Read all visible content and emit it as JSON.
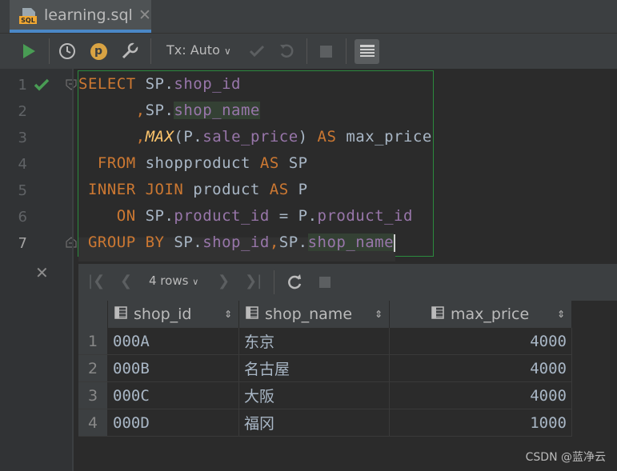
{
  "tab": {
    "name": "learning.sql",
    "icon": "sql-file-icon",
    "close": "✕"
  },
  "toolbar": {
    "tx_mode": "Tx: Auto",
    "p_badge": "p"
  },
  "editor": {
    "line_numbers": [
      "1",
      "2",
      "3",
      "4",
      "5",
      "6",
      "7"
    ],
    "line1": {
      "kw": "SELECT",
      "t1": " SP.",
      "f1": "shop_id"
    },
    "line2": {
      "t0": "      ",
      "comma": ",",
      "t1": "SP.",
      "f1": "shop_name"
    },
    "line3": {
      "t0": "      ",
      "comma": ",",
      "fn": "MAX",
      "t1": "(P.",
      "f1": "sale_price",
      "t2": ") ",
      "kw": "AS",
      "t3": " max_price"
    },
    "line4": {
      "t0": "  ",
      "kw": "FROM",
      "t1": " shopproduct ",
      "kw2": "AS",
      "t2": " SP"
    },
    "line5": {
      "t0": " ",
      "kw": "INNER JOIN",
      "t1": " product ",
      "kw2": "AS",
      "t2": " P"
    },
    "line6": {
      "t0": "    ",
      "kw": "ON",
      "t1": " SP.",
      "f1": "product_id",
      "t2": " = P.",
      "f2": "product_id"
    },
    "line7": {
      "t0": " ",
      "kw": "GROUP BY",
      "t1": " SP.",
      "f1": "shop_id",
      "comma": ",",
      "t2": "SP.",
      "f2": "shop_name"
    }
  },
  "results": {
    "rows_label": "4 rows",
    "columns": [
      "shop_id",
      "shop_name",
      "max_price"
    ],
    "rows": [
      {
        "n": "1",
        "shop_id": "000A",
        "shop_name": "东京",
        "max_price": "4000"
      },
      {
        "n": "2",
        "shop_id": "000B",
        "shop_name": "名古屋",
        "max_price": "4000"
      },
      {
        "n": "3",
        "shop_id": "000C",
        "shop_name": "大阪",
        "max_price": "4000"
      },
      {
        "n": "4",
        "shop_id": "000D",
        "shop_name": "福冈",
        "max_price": "1000"
      }
    ]
  },
  "watermark": "CSDN @蓝净云",
  "colors": {
    "accent": "#4a88c7",
    "run_green": "#499c54",
    "keyword": "#cc7832",
    "field": "#9876aa"
  }
}
